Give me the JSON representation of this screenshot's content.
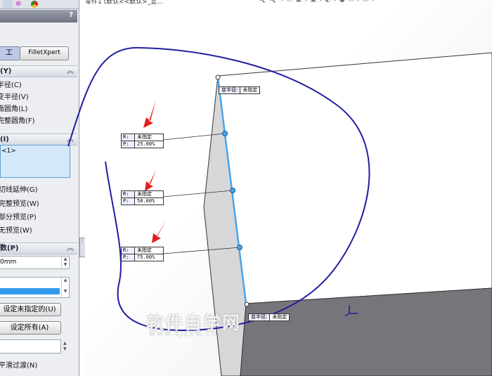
{
  "panel": {
    "help": "?",
    "toggle": {
      "manual": "工",
      "filletxpert": "FilletXpert"
    },
    "type_section": {
      "title": "(Y)",
      "items": [
        "半径(C)",
        "变半径(V)",
        "面圆角(L)",
        "完整圆角(F)"
      ]
    },
    "items_section": {
      "title": "(I)",
      "list_item": "<1>",
      "options": [
        "切线延伸(G)",
        "完整预览(W)",
        "部分预览(P)",
        "无预览(W)"
      ]
    },
    "params_section": {
      "title": "数(P)",
      "radius_value": "0mm",
      "set_unassigned": "设定未指定的(U)",
      "set_all": "设定所有(A)",
      "smooth": "平滑过渡(N)"
    }
  },
  "viewport": {
    "title": "零件1 (默认<<默认>_显...",
    "callouts": [
      {
        "r_label": "R:",
        "r": "未指定",
        "p_label": "P:",
        "p": "25.00%"
      },
      {
        "r_label": "R:",
        "r": "未指定",
        "p_label": "P:",
        "p": "50.00%"
      },
      {
        "r_label": "R:",
        "r": "未指定",
        "p_label": "P:",
        "p": "75.00%"
      }
    ],
    "vertex_labels": [
      {
        "label": "变半径:",
        "value": "未指定"
      },
      {
        "label": "变半径:",
        "value": "未指定"
      }
    ],
    "watermark": "软件自学网",
    "watermark_url": "WWW.RJZXW.COM"
  },
  "colors": {
    "edge": "#4aa3e8",
    "annotation": "#1f1fa0",
    "arrow": "#e02020"
  }
}
